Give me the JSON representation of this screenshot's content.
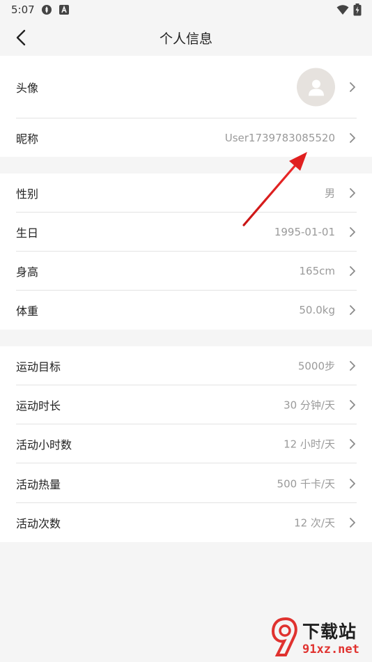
{
  "status_bar": {
    "time": "5:07",
    "icons": [
      "settings-sync-icon",
      "a-badge-icon",
      "wifi-icon",
      "battery-charging-icon"
    ]
  },
  "nav": {
    "title": "个人信息",
    "back_icon": "chevron-left-icon"
  },
  "profile": {
    "avatar_label": "头像",
    "nickname_label": "昵称",
    "nickname_value": "User1739783085520"
  },
  "body_info": {
    "gender_label": "性别",
    "gender_value": "男",
    "birthday_label": "生日",
    "birthday_value": "1995-01-01",
    "height_label": "身高",
    "height_value": "165cm",
    "weight_label": "体重",
    "weight_value": "50.0kg"
  },
  "goals": {
    "steps_label": "运动目标",
    "steps_value": "5000步",
    "duration_label": "运动时长",
    "duration_value": "30 分钟/天",
    "active_hours_label": "活动小时数",
    "active_hours_value": "12 小时/天",
    "calories_label": "活动热量",
    "calories_value": "500 千卡/天",
    "times_label": "活动次数",
    "times_value": "12 次/天"
  },
  "watermark": {
    "title": "下载站",
    "url": "91xz.net"
  },
  "colors": {
    "background": "#f5f5f5",
    "card": "#ffffff",
    "value_text": "#9a9a9a",
    "annotation_arrow": "#e01f1f",
    "watermark_red": "#e0322f"
  }
}
